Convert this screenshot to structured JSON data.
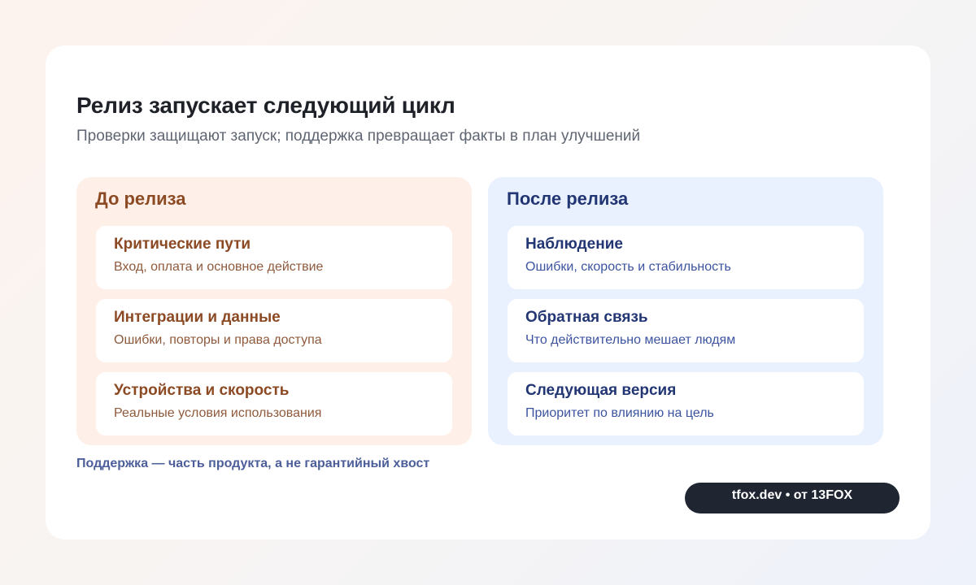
{
  "header": {
    "title": "Релиз запускает следующий цикл",
    "subtitle": "Проверки защищают запуск; поддержка превращает факты в план улучшений"
  },
  "before_release": {
    "heading": "До релиза",
    "accent_color": "#8c4a24",
    "background_color": "#fef0e8",
    "items": [
      {
        "title": "Критические пути",
        "description": "Вход, оплата и основное действие"
      },
      {
        "title": "Интеграции и данные",
        "description": "Ошибки, повторы и права доступа"
      },
      {
        "title": "Устройства и скорость",
        "description": "Реальные условия использования"
      }
    ]
  },
  "after_release": {
    "heading": "После релиза",
    "accent_color": "#233674",
    "background_color": "#eaf1fe",
    "items": [
      {
        "title": "Наблюдение",
        "description": "Ошибки, скорость и стабильность"
      },
      {
        "title": "Обратная связь",
        "description": "Что действительно мешает людям"
      },
      {
        "title": "Следующая версия",
        "description": "Приоритет по влиянию на цель"
      }
    ]
  },
  "footnote": "Поддержка — часть продукта, а не гарантийный хвост",
  "brand": {
    "label": "tfox.dev • от 13FOX",
    "background_color": "#1f2632"
  }
}
